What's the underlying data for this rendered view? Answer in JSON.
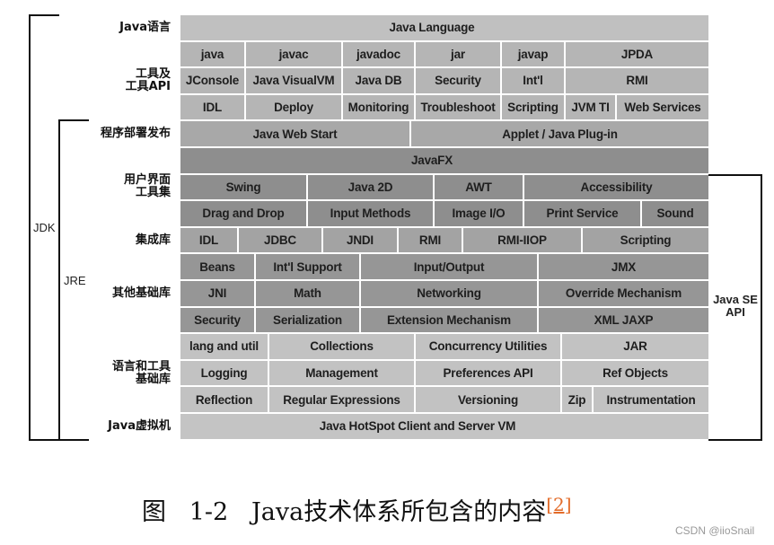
{
  "diagram": {
    "title": "Java技术体系所包含的内容",
    "colors": {
      "lang": "#c0c0c0",
      "tools": "#b5b5b5",
      "deploy": "#a8a8a8",
      "ui": "#8e8e8e",
      "integration": "#a3a3a3",
      "base": "#969696",
      "langutil": "#c2c2c2",
      "vm": "#c4c4c4"
    },
    "row_labels": [
      {
        "text": "Java语言"
      },
      {
        "text": "工具及\n工具API"
      },
      {
        "text": "程序部署发布"
      },
      {
        "text": "用户界面\n工具集"
      },
      {
        "text": "集成库"
      },
      {
        "text": "其他基础库"
      },
      {
        "text": "语言和工具\n基础库"
      },
      {
        "text": "Java虚拟机"
      }
    ],
    "rows": [
      {
        "group": "lang",
        "cells": [
          "Java Language"
        ]
      },
      {
        "group": "tools",
        "cells": [
          "java",
          "javac",
          "javadoc",
          "jar",
          "javap",
          "JPDA"
        ]
      },
      {
        "group": "tools",
        "cells": [
          "JConsole",
          "Java VisualVM",
          "Java DB",
          "Security",
          "Int'l",
          "RMI"
        ]
      },
      {
        "group": "tools",
        "cells": [
          "IDL",
          "Deploy",
          "Monitoring",
          "Troubleshoot",
          "Scripting",
          "JVM TI",
          "Web Services"
        ]
      },
      {
        "group": "deploy",
        "cells": [
          "Java Web Start",
          "Applet / Java Plug-in"
        ]
      },
      {
        "group": "ui",
        "cells": [
          "JavaFX"
        ]
      },
      {
        "group": "ui",
        "cells": [
          "Swing",
          "Java 2D",
          "AWT",
          "Accessibility"
        ]
      },
      {
        "group": "ui",
        "cells": [
          "Drag and Drop",
          "Input Methods",
          "Image I/O",
          "Print Service",
          "Sound"
        ]
      },
      {
        "group": "integration",
        "cells": [
          "IDL",
          "JDBC",
          "JNDI",
          "RMI",
          "RMI-IIOP",
          "Scripting"
        ]
      },
      {
        "group": "base",
        "cells": [
          "Beans",
          "Int'l Support",
          "Input/Output",
          "JMX"
        ]
      },
      {
        "group": "base",
        "cells": [
          "JNI",
          "Math",
          "Networking",
          "Override Mechanism"
        ]
      },
      {
        "group": "base",
        "cells": [
          "Security",
          "Serialization",
          "Extension Mechanism",
          "XML JAXP"
        ]
      },
      {
        "group": "langutil",
        "cells": [
          "lang and util",
          "Collections",
          "Concurrency Utilities",
          "JAR"
        ]
      },
      {
        "group": "langutil",
        "cells": [
          "Logging",
          "Management",
          "Preferences API",
          "Ref Objects"
        ]
      },
      {
        "group": "langutil",
        "cells": [
          "Reflection",
          "Regular Expressions",
          "Versioning",
          "Zip",
          "Instrumentation"
        ]
      },
      {
        "group": "vm",
        "cells": [
          "Java HotSpot Client and Server VM"
        ]
      }
    ],
    "brackets": {
      "jdk": "JDK",
      "jre": "JRE",
      "se_api": "Java SE\nAPI"
    }
  },
  "caption": {
    "prefix": "图   1-2   Java技术体系所包含的内容",
    "ref": "[2]"
  },
  "watermark": "CSDN @iioSnail"
}
